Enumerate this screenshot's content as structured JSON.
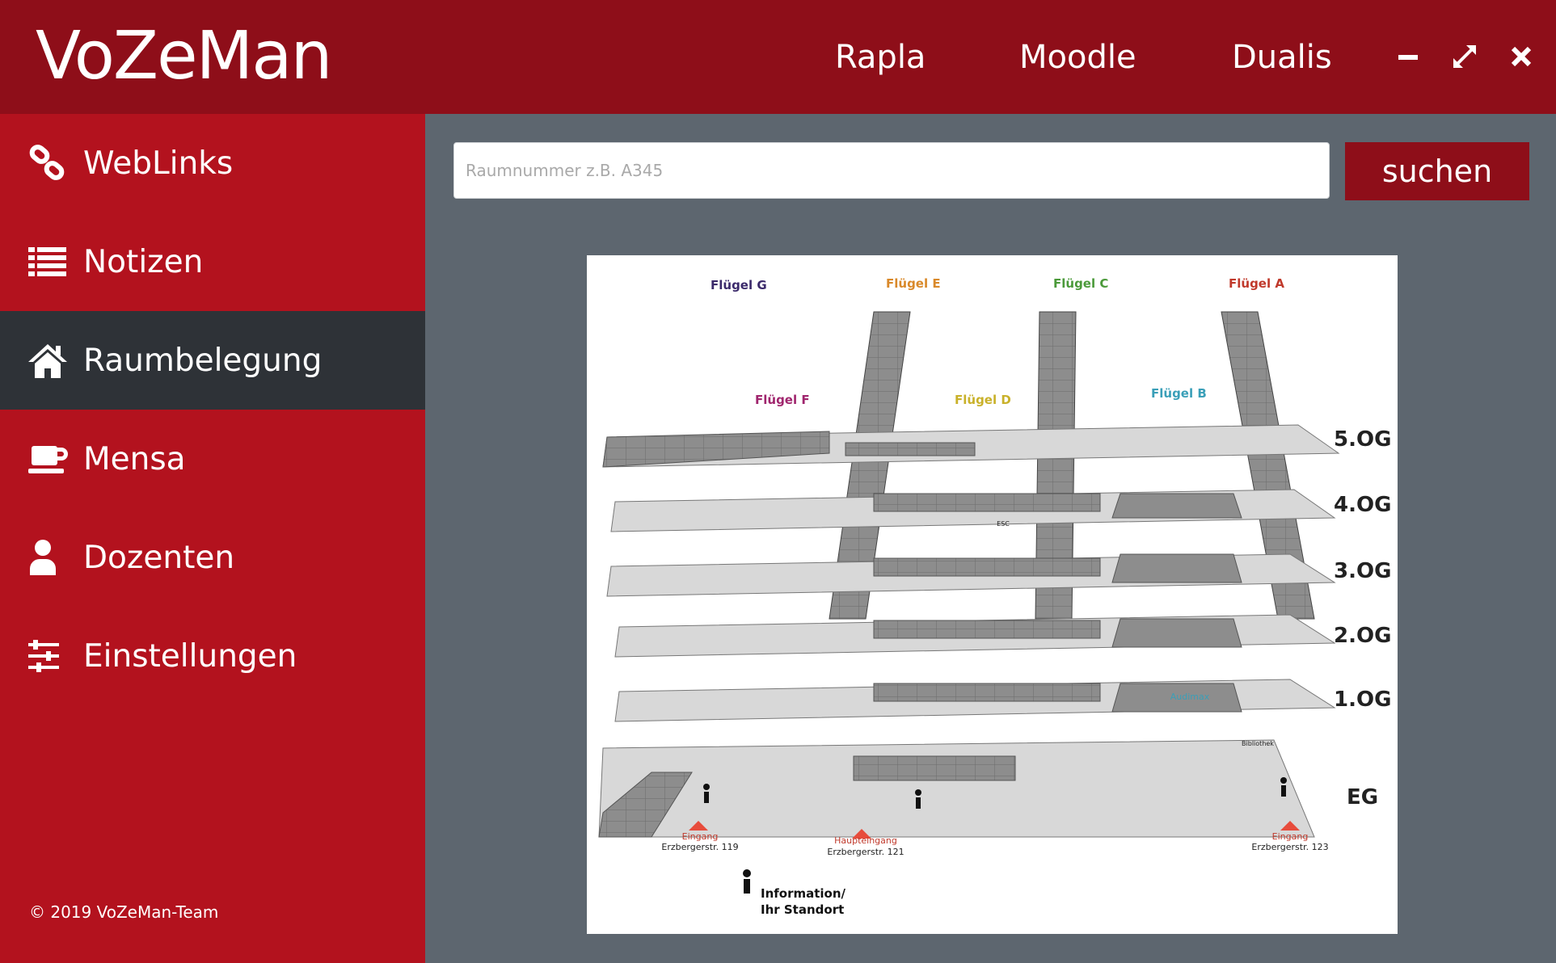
{
  "app": {
    "title": "VoZeMan"
  },
  "header": {
    "nav": [
      {
        "label": "Rapla"
      },
      {
        "label": "Moodle"
      },
      {
        "label": "Dualis"
      }
    ]
  },
  "sidebar": {
    "items": [
      {
        "label": "WebLinks",
        "icon": "link-icon"
      },
      {
        "label": "Notizen",
        "icon": "list-icon"
      },
      {
        "label": "Raumbelegung",
        "icon": "home-icon",
        "active": true
      },
      {
        "label": "Mensa",
        "icon": "coffee-cup-icon"
      },
      {
        "label": "Dozenten",
        "icon": "user-icon"
      },
      {
        "label": "Einstellungen",
        "icon": "sliders-icon"
      }
    ],
    "copyright": "© 2019 VoZeMan-Team"
  },
  "search": {
    "placeholder": "Raumnummer z.B. A345",
    "value": "",
    "button_label": "suchen"
  },
  "map": {
    "wings": [
      {
        "label": "Flügel G",
        "color": "#3b2a6b"
      },
      {
        "label": "Flügel E",
        "color": "#d9892a"
      },
      {
        "label": "Flügel C",
        "color": "#4b9a3a"
      },
      {
        "label": "Flügel A",
        "color": "#c0392b"
      },
      {
        "label": "Flügel F",
        "color": "#a0266e"
      },
      {
        "label": "Flügel D",
        "color": "#c9b12a"
      },
      {
        "label": "Flügel B",
        "color": "#3a9fb8"
      }
    ],
    "floors": [
      "5.OG",
      "4.OG",
      "3.OG",
      "2.OG",
      "1.OG",
      "EG"
    ],
    "entrances": [
      {
        "label": "Eingang",
        "address": "Erzbergerstr. 119"
      },
      {
        "label": "Haupteingang",
        "address": "Erzbergerstr. 121"
      },
      {
        "label": "Eingang",
        "address": "Erzbergerstr. 123"
      }
    ],
    "extra_labels": {
      "auditorium": "Audimax",
      "library": "Bibliothek",
      "esc": "ESC"
    },
    "legend": {
      "line1": "Information/",
      "line2": "Ihr Standort"
    }
  },
  "colors": {
    "header": "#8e0e19",
    "sidebar": "#b3121e",
    "active": "#2e3237",
    "content_bg": "#5d666f"
  }
}
